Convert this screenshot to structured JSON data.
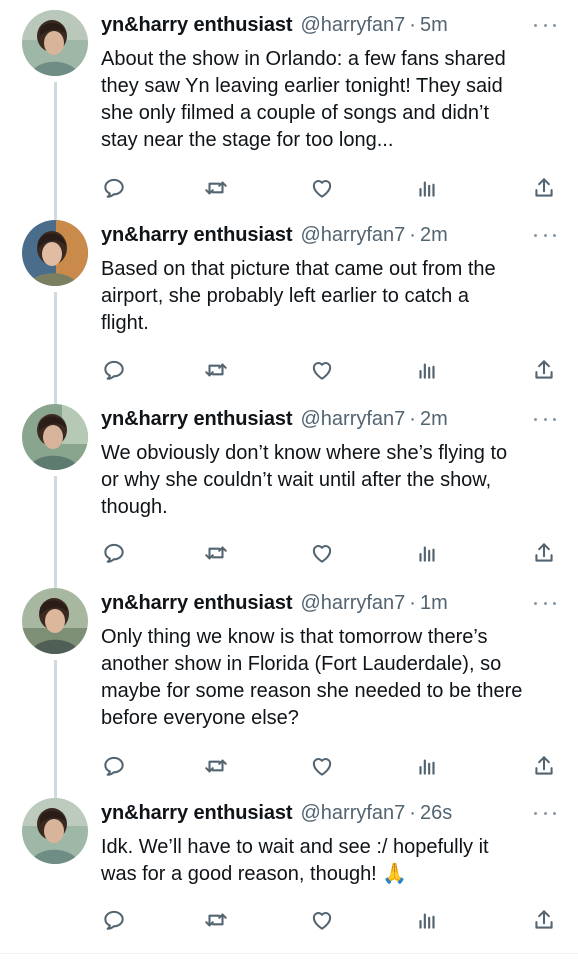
{
  "author": {
    "name": "yn&harry enthusiast",
    "handle": "@harryfan7",
    "dot": "·"
  },
  "tweets": [
    {
      "time": "5m",
      "lines": [
        "About the show in Orlando: a few fans shared",
        "they saw Yn leaving earlier tonight! They said",
        "she only filmed a couple of songs and didn’t",
        "stay near the stage for too long..."
      ]
    },
    {
      "time": "2m",
      "lines": [
        "Based on that picture that came out from the",
        "airport, she probably left earlier to catch a",
        "flight."
      ]
    },
    {
      "time": "2m",
      "lines": [
        "We obviously don’t know where she’s flying to",
        "or why she couldn’t wait until after the show,",
        "though."
      ]
    },
    {
      "time": "1m",
      "lines": [
        "Only thing we know is that tomorrow there’s",
        "another show in Florida (Fort Lauderdale), so",
        "maybe for some reason she needed to be there",
        "before everyone else?"
      ]
    },
    {
      "time": "26s",
      "lines": [
        "Idk. We’ll have to wait and see :/ hopefully it",
        "was for a good reason, though!"
      ],
      "emoji": "🙏"
    }
  ],
  "icons": {
    "avatar": "avatar",
    "more": "more-icon",
    "reply": "reply-icon",
    "retweet": "retweet-icon",
    "like": "like-icon",
    "analytics": "analytics-icon",
    "share": "share-icon"
  },
  "colors": {
    "text": "#0f1419",
    "muted": "#536471",
    "icon": "#536471",
    "thread_line": "#cfd9de"
  }
}
